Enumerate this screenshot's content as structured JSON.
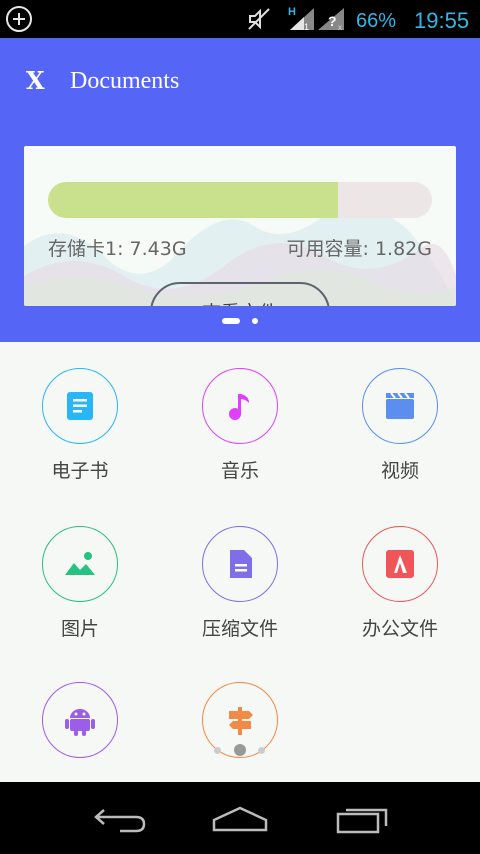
{
  "status_bar": {
    "battery": "66%",
    "time": "19:55",
    "icons": [
      "add-circle-icon",
      "mute-icon",
      "signal-h-icon",
      "signal-unknown-icon"
    ]
  },
  "header": {
    "logo": "X",
    "title": "Documents"
  },
  "storage_card": {
    "label": "存储卡1: 7.43G",
    "available": "可用容量: 1.82G",
    "used_fraction": 0.755,
    "button": "查看文件",
    "colors": {
      "progress_fill": "#c9e08c",
      "progress_track": "#ece6e7"
    }
  },
  "pager": {
    "pages": 2,
    "active": 0
  },
  "categories": [
    {
      "label": "电子书",
      "icon": "ebook-icon",
      "color": "#29b6f6"
    },
    {
      "label": "音乐",
      "icon": "music-icon",
      "color": "#e040fb"
    },
    {
      "label": "视频",
      "icon": "video-icon",
      "color": "#5c8ef0"
    },
    {
      "label": "图片",
      "icon": "image-icon",
      "color": "#26c281"
    },
    {
      "label": "压缩文件",
      "icon": "archive-icon",
      "color": "#7e6ee8"
    },
    {
      "label": "办公文件",
      "icon": "office-icon",
      "color": "#f0555a"
    },
    {
      "label": "",
      "icon": "android-icon",
      "color": "#9c5de8"
    },
    {
      "label": "",
      "icon": "signpost-icon",
      "color": "#f08a45"
    }
  ],
  "grid_indicator": {
    "pages": 3,
    "active": 1
  },
  "colors": {
    "header_bg": "#5566f6",
    "status_text": "#33b5e5"
  }
}
